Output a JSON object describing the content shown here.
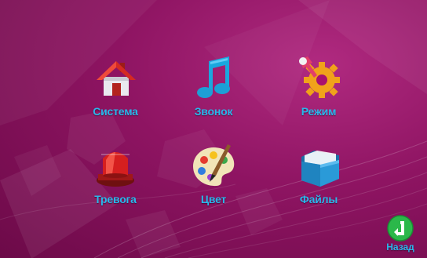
{
  "menu": {
    "items": [
      {
        "label": "Система",
        "icon": "house-icon"
      },
      {
        "label": "Звонок",
        "icon": "music-note-icon"
      },
      {
        "label": "Режим",
        "icon": "gear-wrench-icon"
      },
      {
        "label": "Тревога",
        "icon": "alarm-siren-icon"
      },
      {
        "label": "Цвет",
        "icon": "palette-icon"
      },
      {
        "label": "Файлы",
        "icon": "folder-icon"
      }
    ]
  },
  "back": {
    "label": "Назад",
    "icon": "back-arrow-icon"
  },
  "colors": {
    "background": "#8e1462",
    "label": "#29b7ea",
    "back_button": "#2bb84a"
  }
}
